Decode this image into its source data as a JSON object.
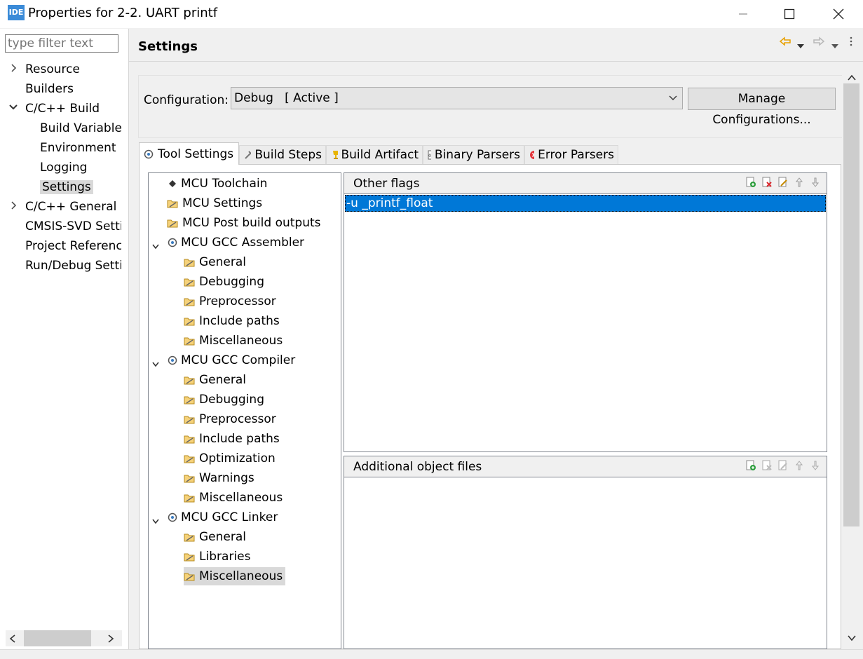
{
  "window": {
    "app_icon_text": "IDE",
    "title": "Properties for 2-2. UART printf"
  },
  "nav": {
    "filter_placeholder": "type filter text",
    "items": [
      {
        "label": "Resource",
        "level": 0,
        "expander": "collapsed"
      },
      {
        "label": "Builders",
        "level": 0,
        "expander": "none"
      },
      {
        "label": "C/C++ Build",
        "level": 0,
        "expander": "expanded"
      },
      {
        "label": "Build Variables",
        "level": 1,
        "expander": "none"
      },
      {
        "label": "Environment",
        "level": 1,
        "expander": "none"
      },
      {
        "label": "Logging",
        "level": 1,
        "expander": "none"
      },
      {
        "label": "Settings",
        "level": 1,
        "expander": "none",
        "selected": true
      },
      {
        "label": "C/C++ General",
        "level": 0,
        "expander": "collapsed"
      },
      {
        "label": "CMSIS-SVD Settings",
        "level": 0,
        "expander": "none"
      },
      {
        "label": "Project References",
        "level": 0,
        "expander": "none"
      },
      {
        "label": "Run/Debug Settings",
        "level": 0,
        "expander": "none"
      }
    ]
  },
  "page": {
    "title": "Settings",
    "configuration_label": "Configuration:",
    "configuration_value": "Debug   [ Active ]",
    "manage_button": "Manage Configurations..."
  },
  "tabs": [
    {
      "label": "Tool Settings",
      "icon": "gear-icon",
      "active": true
    },
    {
      "label": "Build Steps",
      "icon": "hammer-icon"
    },
    {
      "label": "Build Artifact",
      "icon": "trophy-icon"
    },
    {
      "label": "Binary Parsers",
      "icon": "binary-icon"
    },
    {
      "label": "Error Parsers",
      "icon": "error-icon"
    }
  ],
  "tool_tree": [
    {
      "label": "MCU Toolchain",
      "level": 0,
      "icon": "chip-icon"
    },
    {
      "label": "MCU Settings",
      "level": 0,
      "icon": "option-icon"
    },
    {
      "label": "MCU Post build outputs",
      "level": 0,
      "icon": "option-icon"
    },
    {
      "label": "MCU GCC Assembler",
      "level": 0,
      "icon": "tool-icon",
      "expander": "expanded"
    },
    {
      "label": "General",
      "level": 1,
      "icon": "option-icon"
    },
    {
      "label": "Debugging",
      "level": 1,
      "icon": "option-icon"
    },
    {
      "label": "Preprocessor",
      "level": 1,
      "icon": "option-icon"
    },
    {
      "label": "Include paths",
      "level": 1,
      "icon": "option-icon"
    },
    {
      "label": "Miscellaneous",
      "level": 1,
      "icon": "option-icon"
    },
    {
      "label": "MCU GCC Compiler",
      "level": 0,
      "icon": "tool-icon",
      "expander": "expanded"
    },
    {
      "label": "General",
      "level": 1,
      "icon": "option-icon"
    },
    {
      "label": "Debugging",
      "level": 1,
      "icon": "option-icon"
    },
    {
      "label": "Preprocessor",
      "level": 1,
      "icon": "option-icon"
    },
    {
      "label": "Include paths",
      "level": 1,
      "icon": "option-icon"
    },
    {
      "label": "Optimization",
      "level": 1,
      "icon": "option-icon"
    },
    {
      "label": "Warnings",
      "level": 1,
      "icon": "option-icon"
    },
    {
      "label": "Miscellaneous",
      "level": 1,
      "icon": "option-icon"
    },
    {
      "label": "MCU GCC Linker",
      "level": 0,
      "icon": "tool-icon",
      "expander": "expanded"
    },
    {
      "label": "General",
      "level": 1,
      "icon": "option-icon"
    },
    {
      "label": "Libraries",
      "level": 1,
      "icon": "option-icon"
    },
    {
      "label": "Miscellaneous",
      "level": 1,
      "icon": "option-icon",
      "selected": true
    }
  ],
  "other_flags": {
    "title": "Other flags",
    "items": [
      "-u _printf_float"
    ]
  },
  "additional_objects": {
    "title": "Additional object files",
    "items": []
  },
  "colors": {
    "selection": "#0078d7",
    "tree_selection": "#d9d9d9",
    "nav_arrow": "#e8a000"
  }
}
